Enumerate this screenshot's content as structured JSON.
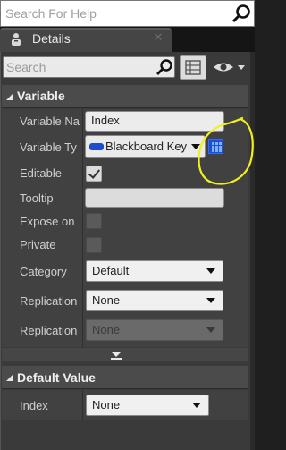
{
  "help_search": {
    "placeholder": "Search For Help"
  },
  "tab": {
    "label": "Details"
  },
  "details_search": {
    "placeholder": "Search"
  },
  "sections": {
    "variable": "Variable",
    "default_value": "Default Value"
  },
  "variable": {
    "name_label": "Variable Na",
    "name_value": "Index",
    "type_label": "Variable Ty",
    "type_value": "Blackboard Key",
    "type_pill_color": "#1b4dcc",
    "editable_label": "Editable",
    "editable_checked": true,
    "tooltip_label": "Tooltip",
    "tooltip_value": "",
    "expose_label": "Expose on",
    "expose_checked": false,
    "private_label": "Private",
    "private_checked": false,
    "category_label": "Category",
    "category_value": "Default",
    "replication1_label": "Replication",
    "replication1_value": "None",
    "replication2_label": "Replication",
    "replication2_value": "None"
  },
  "default_value": {
    "index_label": "Index",
    "index_value": "None"
  },
  "annotation_color": "#f2ef1e"
}
